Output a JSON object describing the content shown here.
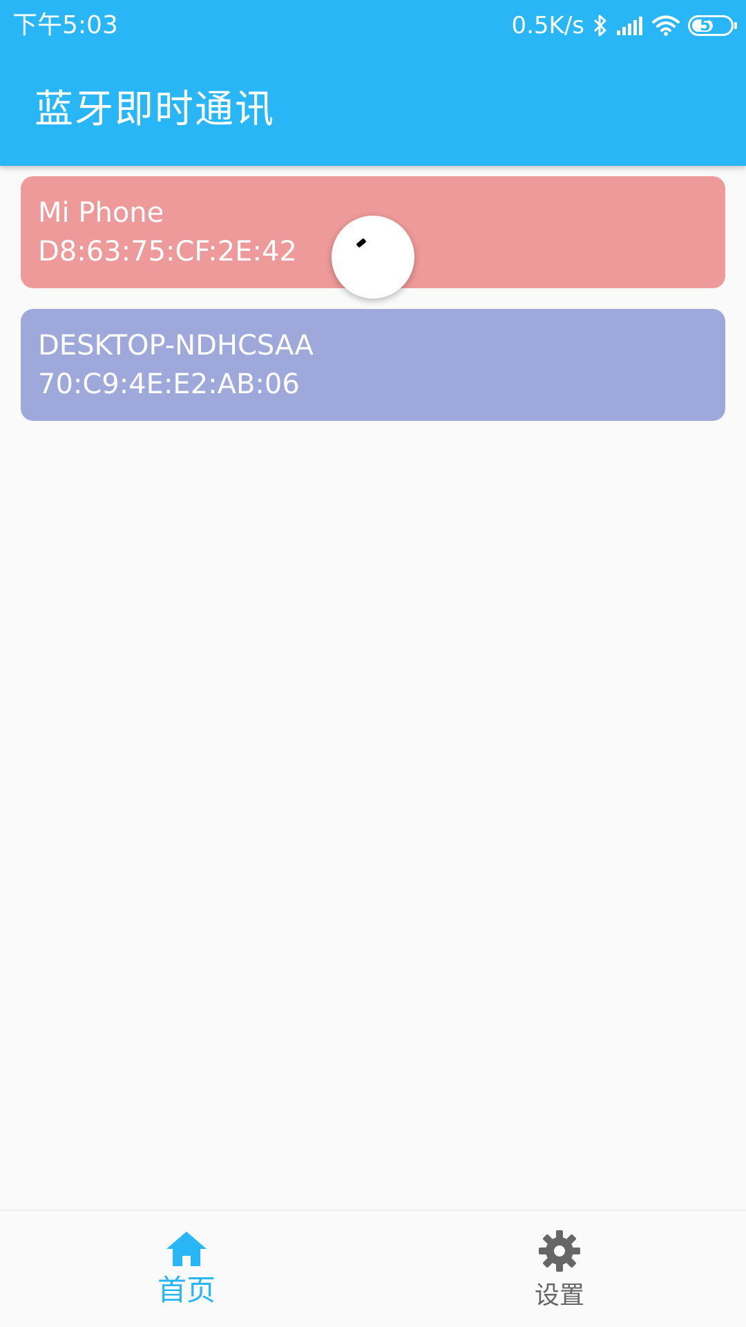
{
  "status_bar": {
    "time": "下午5:03",
    "net_speed": "0.5K/s",
    "icons": [
      "bluetooth-icon",
      "cell-signal-icon",
      "wifi-icon",
      "battery-icon"
    ],
    "battery_level": "55"
  },
  "app_bar": {
    "title": "蓝牙即时通讯",
    "color": "#29b6f6"
  },
  "devices": [
    {
      "name": "Mi Phone",
      "address": "D8:63:75:CF:2E:42",
      "color": "#ef9a9a"
    },
    {
      "name": "DESKTOP-NDHCSAA",
      "address": "70:C9:4E:E2:AB:06",
      "color": "#9fa8da"
    }
  ],
  "loading": {
    "icon": "loading-spinner"
  },
  "bottom_nav": {
    "items": [
      {
        "label": "首页",
        "icon": "home-icon",
        "active": true,
        "color": "#29b6f6"
      },
      {
        "label": "设置",
        "icon": "gear-icon",
        "active": false,
        "color": "#666666"
      }
    ]
  }
}
